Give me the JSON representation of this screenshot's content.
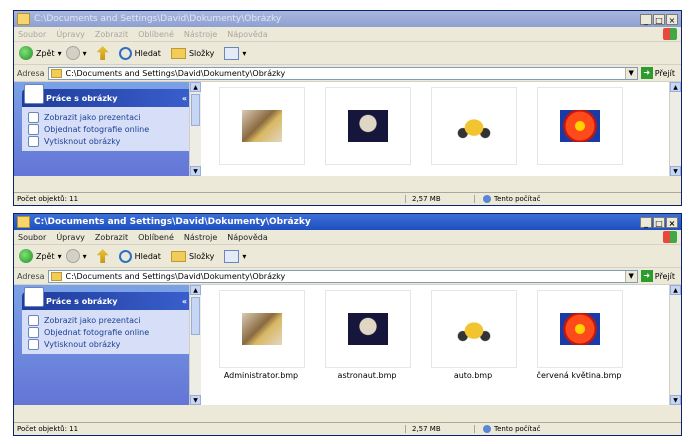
{
  "window1": {
    "title": "C:\\Documents and Settings\\David\\Dokumenty\\Obrázky",
    "menu": [
      "Soubor",
      "Úpravy",
      "Zobrazit",
      "Oblíbené",
      "Nástroje",
      "Nápověda"
    ],
    "toolbar": {
      "back": "Zpět",
      "search": "Hledat",
      "folders": "Složky"
    },
    "address": {
      "label": "Adresa",
      "value": "C:\\Documents and Settings\\David\\Dokumenty\\Obrázky",
      "go": "Přejít"
    },
    "taskpane": {
      "title": "Práce s obrázky",
      "items": [
        "Zobrazit jako prezentaci",
        "Objednat fotografie online",
        "Vytisknout obrázky"
      ]
    },
    "status": {
      "count": "Počet objektů: 11",
      "size": "2,57 MB",
      "zone": "Tento počítač"
    }
  },
  "window2": {
    "title": "C:\\Documents and Settings\\David\\Dokumenty\\Obrázky",
    "menu": [
      "Soubor",
      "Úpravy",
      "Zobrazit",
      "Oblíbené",
      "Nástroje",
      "Nápověda"
    ],
    "toolbar": {
      "back": "Zpět",
      "search": "Hledat",
      "folders": "Složky"
    },
    "address": {
      "label": "Adresa",
      "value": "C:\\Documents and Settings\\David\\Dokumenty\\Obrázky",
      "go": "Přejít"
    },
    "taskpane": {
      "title": "Práce s obrázky",
      "items": [
        "Zobrazit jako prezentaci",
        "Objednat fotografie online",
        "Vytisknout obrázky"
      ]
    },
    "files": [
      "Administrator.bmp",
      "astronaut.bmp",
      "auto.bmp",
      "červená květina.bmp"
    ],
    "status": {
      "count": "Počet objektů: 11",
      "size": "2,57 MB",
      "zone": "Tento počítač"
    }
  },
  "window_controls": {
    "minimize": "_",
    "maximize": "□",
    "close": "×"
  },
  "colors": {
    "title_active": "#1d4fbf",
    "title_inactive": "#8ea0d0",
    "taskpane": "#6375d6",
    "chrome": "#ece9d8"
  },
  "icons": [
    "back-icon",
    "forward-icon",
    "up-folder-icon",
    "search-icon",
    "folders-icon",
    "views-icon",
    "go-icon",
    "windows-flag-icon"
  ]
}
